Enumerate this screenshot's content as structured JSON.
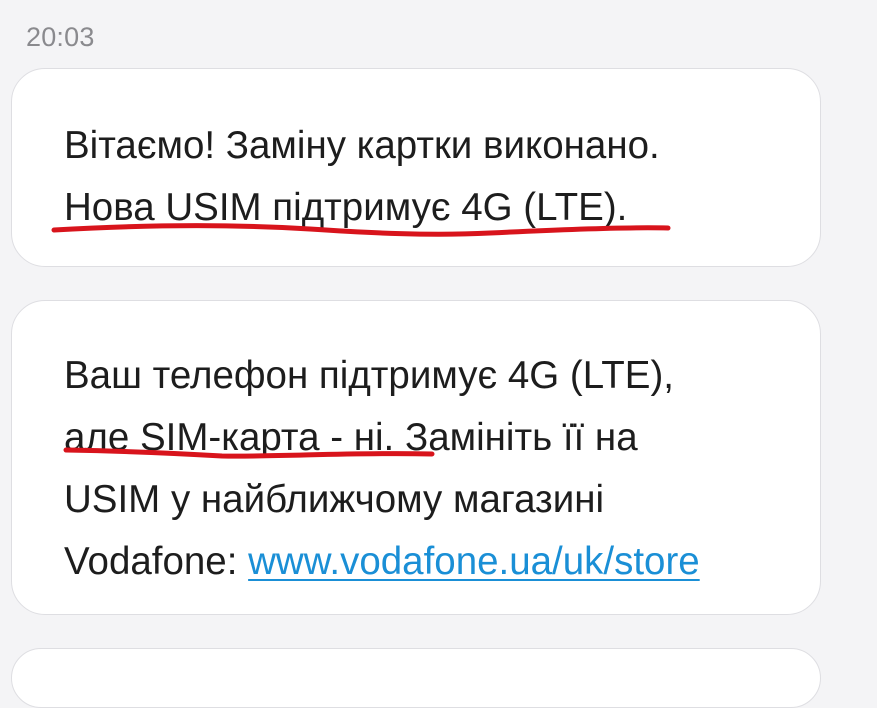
{
  "timestamp": "20:03",
  "messages": [
    {
      "lines": [
        "Вітаємо! Заміну картки виконано.",
        "Нова USIM підтримує 4G (LTE)."
      ]
    },
    {
      "lines": [
        "Ваш телефон підтримує 4G (LTE),",
        "але SIM-карта - ні. Замініть її на",
        "USIM у найближчому магазині"
      ],
      "last_line_prefix": "Vodafone: ",
      "link_text": "www.vodafone.ua/uk/store"
    }
  ],
  "annotations": {
    "underline_color": "#d8141c"
  }
}
